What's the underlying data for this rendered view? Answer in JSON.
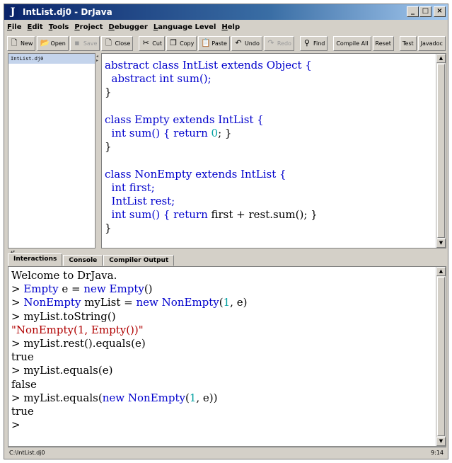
{
  "window": {
    "title": "IntList.dj0 - DrJava",
    "app_icon_glyph": "J",
    "minimize_glyph": "_",
    "maximize_glyph": "□",
    "close_glyph": "×"
  },
  "menu": [
    {
      "first": "F",
      "rest": "ile"
    },
    {
      "first": "E",
      "rest": "dit"
    },
    {
      "first": "T",
      "rest": "ools"
    },
    {
      "first": "P",
      "rest": "roject"
    },
    {
      "first": "D",
      "rest": "ebugger"
    },
    {
      "first": "L",
      "rest": "anguage Level"
    },
    {
      "first": "H",
      "rest": "elp"
    }
  ],
  "toolbar": {
    "new": "New",
    "open": "Open",
    "save": "Save",
    "close": "Close",
    "cut": "Cut",
    "copy": "Copy",
    "paste": "Paste",
    "undo": "Undo",
    "redo": "Redo",
    "find": "Find",
    "compile_all": "Compile All",
    "reset": "Reset",
    "test": "Test",
    "javadoc": "Javadoc"
  },
  "files": [
    "IntList.dj0"
  ],
  "editor": {
    "lines": [
      [
        {
          "t": "abstract class IntList extends Object {",
          "c": "kw"
        }
      ],
      [
        {
          "t": "  abstract int sum();",
          "c": "kw"
        }
      ],
      [
        {
          "t": "}",
          "c": ""
        }
      ],
      [
        {
          "t": "",
          "c": ""
        }
      ],
      [
        {
          "t": "class Empty extends IntList {",
          "c": "kw"
        }
      ],
      [
        {
          "t": "  int sum() { ",
          "c": "kw"
        },
        {
          "t": "return",
          "c": "kw"
        },
        {
          "t": " ",
          "c": ""
        },
        {
          "t": "0",
          "c": "num"
        },
        {
          "t": "; }",
          "c": ""
        }
      ],
      [
        {
          "t": "}",
          "c": ""
        }
      ],
      [
        {
          "t": "",
          "c": ""
        }
      ],
      [
        {
          "t": "class NonEmpty extends IntList {",
          "c": "kw"
        }
      ],
      [
        {
          "t": "  int first;",
          "c": "kw"
        }
      ],
      [
        {
          "t": "  IntList rest;",
          "c": "kw"
        }
      ],
      [
        {
          "t": "  int sum() { ",
          "c": "kw"
        },
        {
          "t": "return",
          "c": "kw"
        },
        {
          "t": " first + rest.sum(); }",
          "c": ""
        }
      ],
      [
        {
          "t": "}",
          "c": ""
        }
      ]
    ]
  },
  "tabs": [
    "Interactions",
    "Console",
    "Compiler Output"
  ],
  "interactions": {
    "lines": [
      [
        {
          "t": "Welcome to DrJava.",
          "c": ""
        }
      ],
      [
        {
          "t": "> ",
          "c": ""
        },
        {
          "t": "Empty",
          "c": "kw"
        },
        {
          "t": " e = ",
          "c": ""
        },
        {
          "t": "new",
          "c": "kw"
        },
        {
          "t": " ",
          "c": ""
        },
        {
          "t": "Empty",
          "c": "kw"
        },
        {
          "t": "()",
          "c": ""
        }
      ],
      [
        {
          "t": "> ",
          "c": ""
        },
        {
          "t": "NonEmpty",
          "c": "kw"
        },
        {
          "t": " myList = ",
          "c": ""
        },
        {
          "t": "new",
          "c": "kw"
        },
        {
          "t": " ",
          "c": ""
        },
        {
          "t": "NonEmpty",
          "c": "kw"
        },
        {
          "t": "(",
          "c": ""
        },
        {
          "t": "1",
          "c": "num"
        },
        {
          "t": ", e)",
          "c": ""
        }
      ],
      [
        {
          "t": "> myList.toString()",
          "c": ""
        }
      ],
      [
        {
          "t": "\"NonEmpty(1, Empty())\"",
          "c": "str"
        }
      ],
      [
        {
          "t": "> myList.rest().equals(e)",
          "c": ""
        }
      ],
      [
        {
          "t": "true",
          "c": ""
        }
      ],
      [
        {
          "t": "> myList.equals(e)",
          "c": ""
        }
      ],
      [
        {
          "t": "false",
          "c": ""
        }
      ],
      [
        {
          "t": "> myList.equals(",
          "c": ""
        },
        {
          "t": "new",
          "c": "kw"
        },
        {
          "t": " ",
          "c": ""
        },
        {
          "t": "NonEmpty",
          "c": "kw"
        },
        {
          "t": "(",
          "c": ""
        },
        {
          "t": "1",
          "c": "num"
        },
        {
          "t": ", e))",
          "c": ""
        }
      ],
      [
        {
          "t": "true",
          "c": ""
        }
      ],
      [
        {
          "t": ">",
          "c": ""
        }
      ]
    ]
  },
  "status": {
    "path": "C:\\IntList.dj0",
    "position": "9:14"
  },
  "colors": {
    "keyword": "#0000cc",
    "number": "#00a0a0",
    "string": "#b00000",
    "title_gradient_start": "#0a246a"
  }
}
